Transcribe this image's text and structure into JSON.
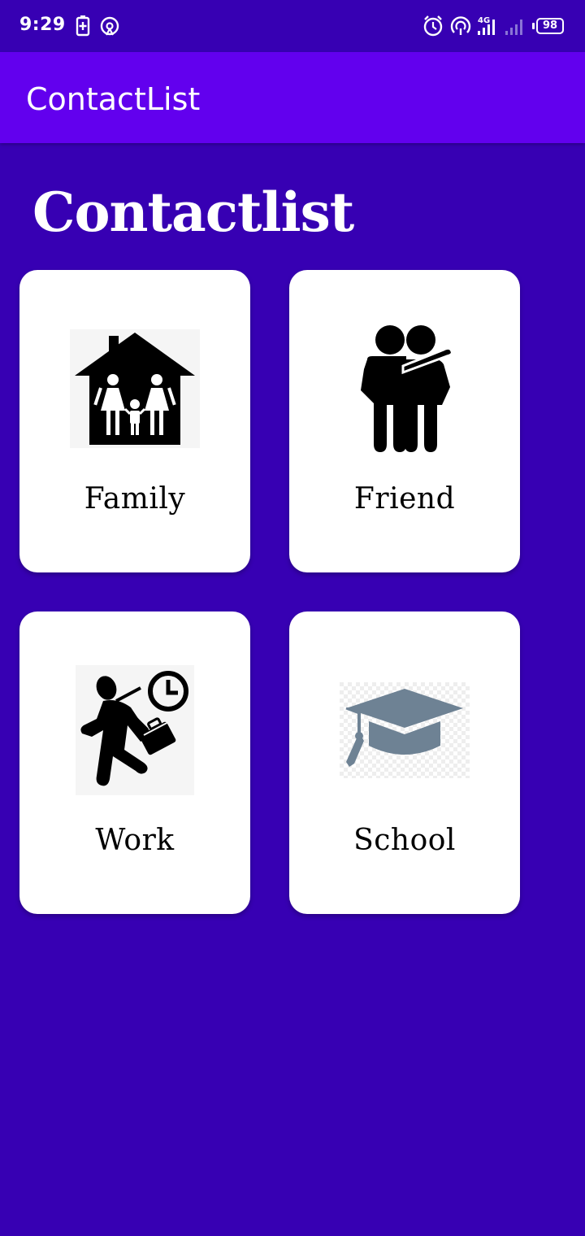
{
  "status_bar": {
    "time": "9:29",
    "battery_level": "98",
    "icons": [
      "battery-charging-icon",
      "hotspot-icon",
      "alarm-icon",
      "wifi-hotspot-icon",
      "signal-4g-icon",
      "signal-weak-icon",
      "battery-icon"
    ]
  },
  "app_bar": {
    "title": "ContactList"
  },
  "page": {
    "heading": "Contactlist"
  },
  "categories": [
    {
      "label": "Family",
      "icon": "family-house-icon"
    },
    {
      "label": "Friend",
      "icon": "friends-icon"
    },
    {
      "label": "Work",
      "icon": "work-commute-icon"
    },
    {
      "label": "School",
      "icon": "graduation-cap-icon"
    }
  ],
  "colors": {
    "background": "#3700b3",
    "app_bar": "#6200ee",
    "card": "#ffffff",
    "school_icon": "#6e8294"
  }
}
